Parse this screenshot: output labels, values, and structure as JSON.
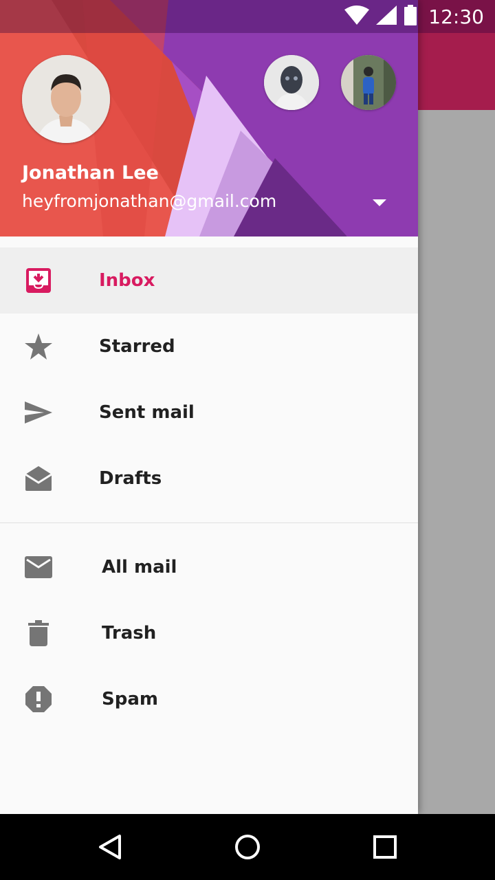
{
  "status_bar": {
    "time": "12:30"
  },
  "account": {
    "name": "Jonathan Lee",
    "email": "heyfromjonathan@gmail.com"
  },
  "nav": {
    "primary": [
      {
        "label": "Inbox",
        "icon": "inbox-icon",
        "active": true
      },
      {
        "label": "Starred",
        "icon": "star-icon"
      },
      {
        "label": "Sent mail",
        "icon": "send-icon"
      },
      {
        "label": "Drafts",
        "icon": "drafts-icon"
      }
    ],
    "secondary": [
      {
        "label": "All mail",
        "icon": "mail-icon"
      },
      {
        "label": "Trash",
        "icon": "trash-icon"
      },
      {
        "label": "Spam",
        "icon": "spam-icon"
      }
    ]
  },
  "colors": {
    "accent": "#d81b60",
    "icon_grey": "#757575",
    "toolbar_behind": "#a51d4d",
    "header_purple": "#8e3bb0",
    "header_red": "#e8564d"
  }
}
